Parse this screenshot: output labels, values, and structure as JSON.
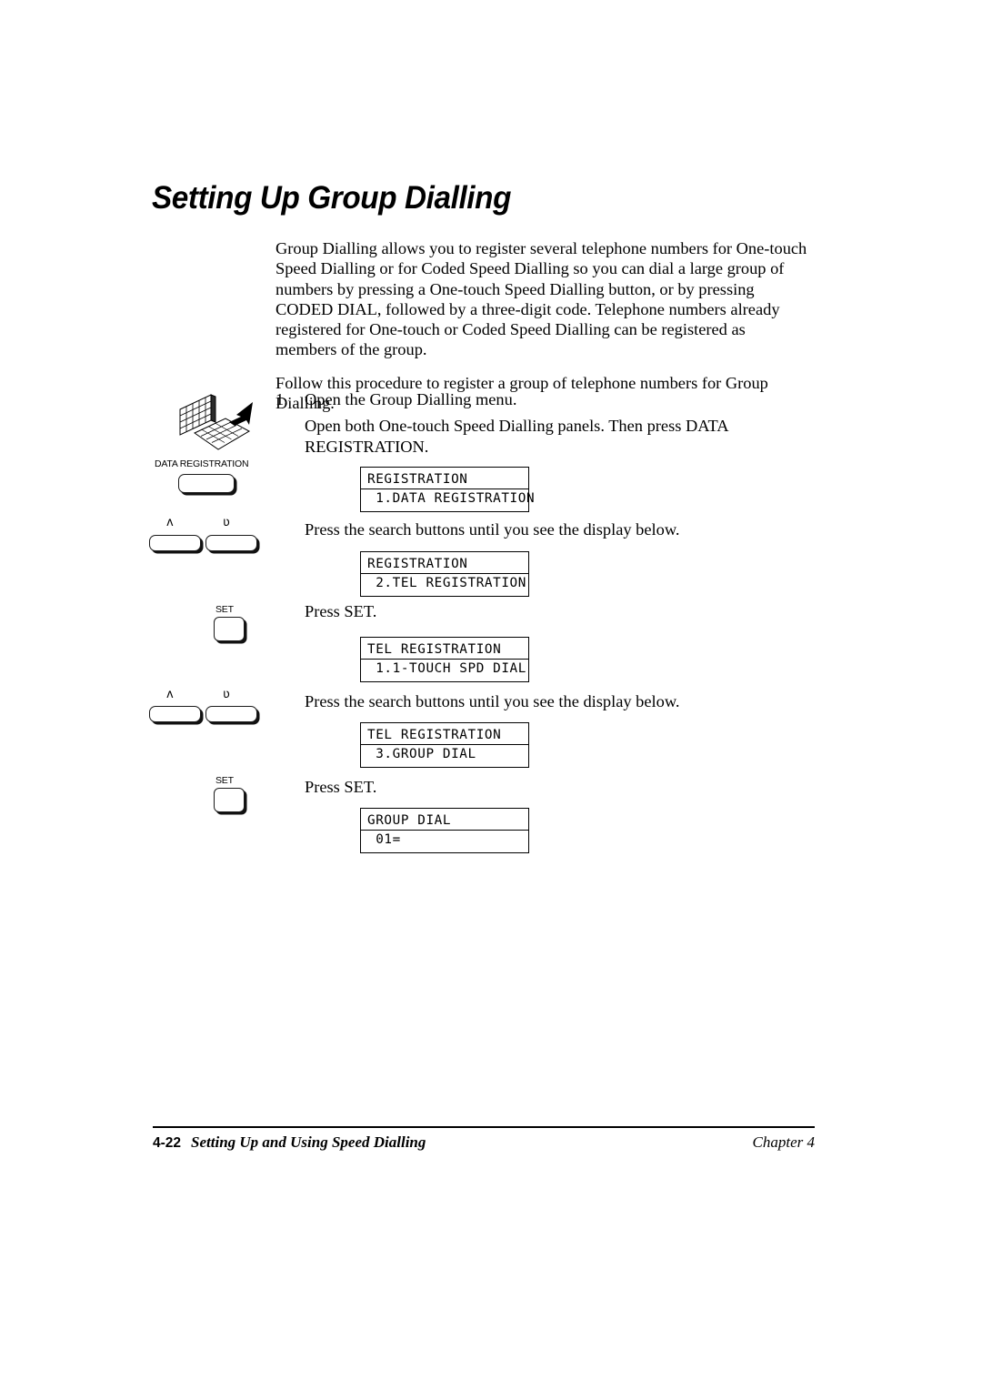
{
  "document": {
    "title": "Setting Up Group Dialling"
  },
  "intro": {
    "paragraph1": "Group Dialling allows you to register several telephone numbers for One-touch Speed Dialling or for Coded Speed Dialling so you can dial a large group of numbers by pressing a One-touch Speed Dialling button, or by pressing CODED DIAL, followed by a three-digit code. Telephone numbers already registered for One-touch or Coded Speed Dialling can be registered as members of the group.",
    "paragraph2": "Follow this procedure to register a group of telephone numbers for Group Dialling."
  },
  "step": {
    "number": "1.",
    "heading": "Open the Group Dialling menu.",
    "detail": "Open both One-touch Speed Dialling panels. Then press DATA REGISTRATION."
  },
  "instructions": {
    "search1": "Press the search buttons until you see the display below.",
    "set1": "Press SET.",
    "search2": "Press the search buttons until you see the display below.",
    "set2": "Press SET."
  },
  "buttons": {
    "data_registration": "DATA REGISTRATION",
    "search_up": "ʌ",
    "search_down": "ʋ",
    "set": "SET"
  },
  "displays": [
    {
      "name": "registration-data-registration",
      "line1": "REGISTRATION",
      "line2": " 1.DATA REGISTRATION"
    },
    {
      "name": "registration-tel-registration",
      "line1": "REGISTRATION",
      "line2": " 2.TEL REGISTRATION"
    },
    {
      "name": "tel-registration-1touch-spd-dial",
      "line1": "TEL REGISTRATION",
      "line2": " 1.1-TOUCH SPD DIAL"
    },
    {
      "name": "tel-registration-group-dial",
      "line1": "TEL REGISTRATION",
      "line2": " 3.GROUP DIAL"
    },
    {
      "name": "group-dial-01",
      "line1": "GROUP DIAL",
      "line2": " 01="
    }
  ],
  "footer": {
    "page_number": "4-22",
    "section_title": "Setting Up and Using Speed Dialling",
    "chapter": "Chapter 4"
  },
  "colors": {
    "ink": "#000000",
    "paper": "#ffffff"
  }
}
